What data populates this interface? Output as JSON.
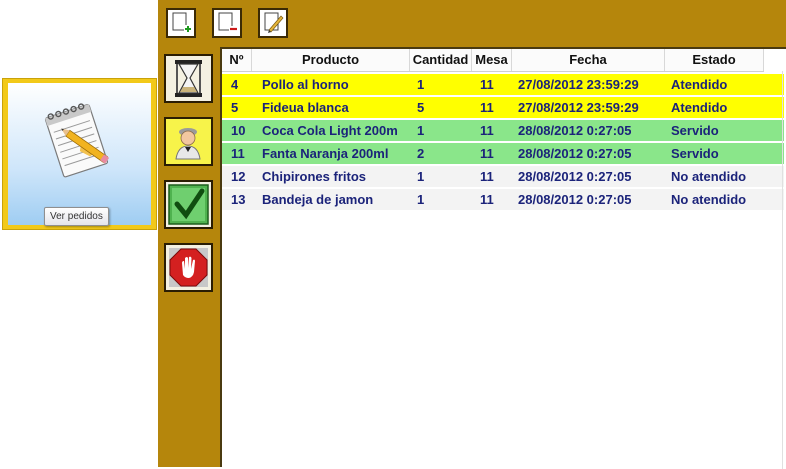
{
  "launcher": {
    "tooltip": "Ver pedidos",
    "icon": "notepad-pencil-icon"
  },
  "toolbar": {
    "add_icon": "new-document-plus-icon",
    "remove_icon": "delete-document-minus-icon",
    "edit_icon": "edit-document-pencil-icon"
  },
  "sidebar": [
    {
      "icon": "hourglass-icon"
    },
    {
      "icon": "waiter-icon"
    },
    {
      "icon": "checkmark-icon"
    },
    {
      "icon": "stop-hand-icon"
    }
  ],
  "table": {
    "columns": [
      "Nº",
      "Producto",
      "Cantidad",
      "Mesa",
      "Fecha",
      "Estado"
    ],
    "rows": [
      {
        "n": "4",
        "producto": "Pollo al horno",
        "cantidad": "1",
        "mesa": "11",
        "fecha": "27/08/2012 23:59:29",
        "estado": "Atendido"
      },
      {
        "n": "5",
        "producto": "Fideua blanca",
        "cantidad": "5",
        "mesa": "11",
        "fecha": "27/08/2012 23:59:29",
        "estado": "Atendido"
      },
      {
        "n": "10",
        "producto": "Coca Cola Light 200m",
        "cantidad": "1",
        "mesa": "11",
        "fecha": "28/08/2012 0:27:05",
        "estado": "Servido"
      },
      {
        "n": "11",
        "producto": "Fanta Naranja 200ml",
        "cantidad": "2",
        "mesa": "11",
        "fecha": "28/08/2012 0:27:05",
        "estado": "Servido"
      },
      {
        "n": "12",
        "producto": "Chipirones fritos",
        "cantidad": "1",
        "mesa": "11",
        "fecha": "28/08/2012 0:27:05",
        "estado": "No atendido"
      },
      {
        "n": "13",
        "producto": "Bandeja de jamon",
        "cantidad": "1",
        "mesa": "11",
        "fecha": "28/08/2012 0:27:05",
        "estado": "No atendido"
      }
    ]
  },
  "colors": {
    "frame": "#b5860c",
    "atendido": "#ffff00",
    "servido": "#8ae68a",
    "no_atendido": "#f3f3f3",
    "text": "#1b237a"
  }
}
